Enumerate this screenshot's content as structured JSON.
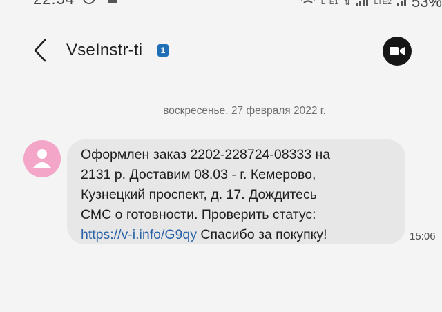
{
  "status_bar": {
    "time": "22:54",
    "network_1": "LTE1",
    "network_2": "LTE2",
    "battery": "53%"
  },
  "header": {
    "contact_name": "VseInstr-ti",
    "sim_badge": "1",
    "back_icon": "chevron-left-icon",
    "video_icon": "video-camera-icon"
  },
  "conversation": {
    "date_separator": "воскресенье, 27 февраля 2022 г.",
    "messages": [
      {
        "text_lines": "Оформлен заказ 2202-228724-08333 на\n2131 р. Доставим 08.03 - г. Кемерово,\nКузнецкий проспект, д. 17. Дождитесь\nСМС о готовности. Проверить статус:\n",
        "link": "https://v-i.info/G9qy",
        "text_after_link": " Спасибо за покупку!",
        "time": "15:06"
      }
    ]
  },
  "colors": {
    "bubble": "#e7e7e7",
    "avatar": "#f3a6c8",
    "link": "#2a63a8",
    "sim_badge": "#1e6fb5"
  }
}
